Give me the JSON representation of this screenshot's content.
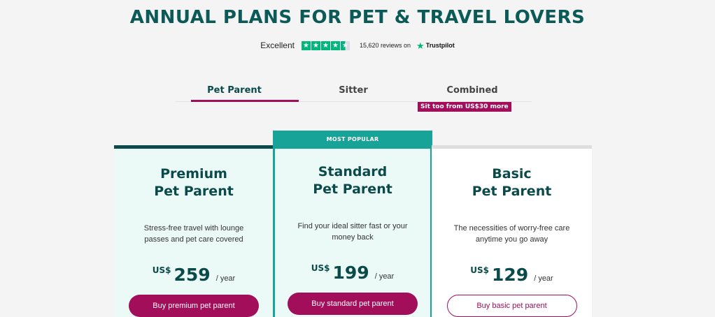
{
  "header": {
    "title": "ANNUAL PLANS FOR PET & TRAVEL LOVERS"
  },
  "trustpilot": {
    "rating_text": "Excellent",
    "stars": 4.5,
    "reviews_text": "15,620 reviews on",
    "brand": "Trustpilot",
    "brand_color": "#00b67a"
  },
  "tabs": [
    {
      "label": "Pet Parent",
      "active": true
    },
    {
      "label": "Sitter",
      "active": false
    },
    {
      "label": "Combined",
      "active": false
    }
  ],
  "tab_badge": "Sit too from US$30 more",
  "plans": [
    {
      "name_line1": "Premium",
      "name_line2": "Pet Parent",
      "description": "Stress-free travel with lounge passes and pet care covered",
      "currency": "US$",
      "price": "259",
      "period": "/ year",
      "button": "Buy premium pet parent"
    },
    {
      "badge": "MOST POPULAR",
      "name_line1": "Standard",
      "name_line2": "Pet Parent",
      "description": "Find your ideal sitter fast or your money back",
      "currency": "US$",
      "price": "199",
      "period": "/ year",
      "button": "Buy standard pet parent"
    },
    {
      "name_line1": "Basic",
      "name_line2": "Pet Parent",
      "description": "The necessities of worry-free care anytime you go away",
      "currency": "US$",
      "price": "129",
      "period": "/ year",
      "button": "Buy basic pet parent"
    }
  ],
  "colors": {
    "accent": "#a30e5a",
    "teal": "#17a397",
    "dark_teal": "#0b4a4a"
  }
}
